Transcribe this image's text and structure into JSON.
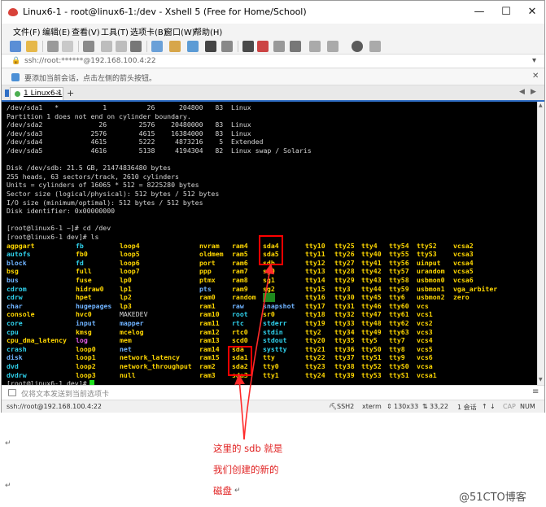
{
  "window": {
    "title": "Linux6-1 - root@linux6-1:/dev - Xshell 5 (Free for Home/School)",
    "controls": {
      "minimize": "—",
      "maximize": "☐",
      "close": "✕"
    }
  },
  "menu": [
    "文件(F)",
    "编辑(E)",
    "查看(V)",
    "工具(T)",
    "选项卡(B)",
    "窗口(W)",
    "帮助(H)"
  ],
  "address": {
    "text": "ssh://root:******@192.168.100.4:22"
  },
  "hint": {
    "text": "要添加当前会话，点击左侧的箭头按钮。"
  },
  "tabs": [
    {
      "label": "1 Linux6-1"
    }
  ],
  "terminal": {
    "lines": [
      "/dev/sda1   *           1          26      204800   83  Linux",
      "Partition 1 does not end on cylinder boundary.",
      "/dev/sda2              26        2576    20480000   83  Linux",
      "/dev/sda3            2576        4615    16384000   83  Linux",
      "/dev/sda4            4615        5222     4873216    5  Extended",
      "/dev/sda5            4616        5138     4194304   82  Linux swap / Solaris",
      "",
      "Disk /dev/sdb: 21.5 GB, 21474836480 bytes",
      "255 heads, 63 sectors/track, 2610 cylinders",
      "Units = cylinders of 16065 * 512 = 8225280 bytes",
      "Sector size (logical/physical): 512 bytes / 512 bytes",
      "I/O size (minimum/optimal): 512 bytes / 512 bytes",
      "Disk identifier: 0x00000000",
      "",
      "[root@linux6-1 ~]# cd /dev",
      "[root@linux6-1 dev]# ls"
    ],
    "ls_columns": [
      [
        "agpgart",
        "autofs",
        "block",
        "bsg",
        "bus",
        "cdrom",
        "cdrw",
        "char",
        "console",
        "core",
        "cpu",
        "cpu_dma_latency",
        "crash",
        "disk",
        "dvd",
        "dvdrw"
      ],
      [
        "fb",
        "fb0",
        "fd",
        "full",
        "fuse",
        "hidraw0",
        "hpet",
        "hugepages",
        "hvc0",
        "input",
        "kmsg",
        "log",
        "loop0",
        "loop1",
        "loop2",
        "loop3"
      ],
      [
        "loop4",
        "loop5",
        "loop6",
        "loop7",
        "lp0",
        "lp1",
        "lp2",
        "lp3",
        "MAKEDEV",
        "mapper",
        "mcelog",
        "mem",
        "net",
        "network_latency",
        "network_throughput",
        "null"
      ],
      [
        "nvram",
        "oldmem",
        "port",
        "ppp",
        "ptmx",
        "pts",
        "ram0",
        "ram1",
        "ram10",
        "ram11",
        "ram12",
        "ram13",
        "ram14",
        "ram15",
        "ram2",
        "ram3"
      ],
      [
        "ram4",
        "ram5",
        "ram6",
        "ram7",
        "ram8",
        "ram9",
        "random",
        "raw",
        "root",
        "rtc",
        "rtc0",
        "scd0",
        "sda",
        "sda1",
        "sda2",
        "sda3"
      ],
      [
        "sda4",
        "sda5",
        "sdb",
        "sg0",
        "sg1",
        "sg2",
        "shm",
        "snapshot",
        "sr0",
        "stderr",
        "stdin",
        "stdout",
        "systty",
        "tty",
        "tty0",
        "tty1"
      ],
      [
        "tty10",
        "tty11",
        "tty12",
        "tty13",
        "tty14",
        "tty15",
        "tty16",
        "tty17",
        "tty18",
        "tty19",
        "tty2",
        "tty20",
        "tty21",
        "tty22",
        "tty23",
        "tty24"
      ],
      [
        "tty25",
        "tty26",
        "tty27",
        "tty28",
        "tty29",
        "tty3",
        "tty30",
        "tty31",
        "tty32",
        "tty33",
        "tty34",
        "tty35",
        "tty36",
        "tty37",
        "tty38",
        "tty39"
      ],
      [
        "tty4",
        "tty40",
        "tty41",
        "tty42",
        "tty43",
        "tty44",
        "tty45",
        "tty46",
        "tty47",
        "tty48",
        "tty49",
        "tty5",
        "tty50",
        "tty51",
        "tty52",
        "tty53"
      ],
      [
        "tty54",
        "tty55",
        "tty56",
        "tty57",
        "tty58",
        "tty59",
        "tty6",
        "tty60",
        "tty61",
        "tty62",
        "tty63",
        "tty7",
        "tty8",
        "tty9",
        "ttyS0",
        "ttyS1"
      ],
      [
        "ttyS2",
        "ttyS3",
        "uinput",
        "urandom",
        "usbmon0",
        "usbmon1",
        "usbmon2",
        "vcs",
        "vcs1",
        "vcs2",
        "vcs3",
        "vcs4",
        "vcs5",
        "vcs6",
        "vcsa",
        "vcsa1"
      ],
      [
        "vcsa2",
        "vcsa3",
        "vcsa4",
        "vcsa5",
        "vcsa6",
        "vga_arbiter",
        "zero",
        "",
        "",
        "",
        "",
        "",
        "",
        "",
        "",
        ""
      ]
    ],
    "final_prompt": "[root@linux6-1 dev]# "
  },
  "input_bar": {
    "text": "仅将文本发送到当前选项卡"
  },
  "status": {
    "connection": "ssh://root@192.168.100.4:22",
    "protocol": "SSH2",
    "terminal": "xterm",
    "size": "130x33",
    "position": "33,22",
    "sessions": "1 会话",
    "cap": "CAP",
    "num": "NUM"
  },
  "annotation": [
    "这里的 sdb 就是",
    "我们创建的新的",
    "磁盘"
  ],
  "watermark": "@51CTO博客",
  "colors": {
    "terminal_bg": "#000000",
    "annotation_red": "#ff0000",
    "tab_accent": "#2f6ec5"
  }
}
